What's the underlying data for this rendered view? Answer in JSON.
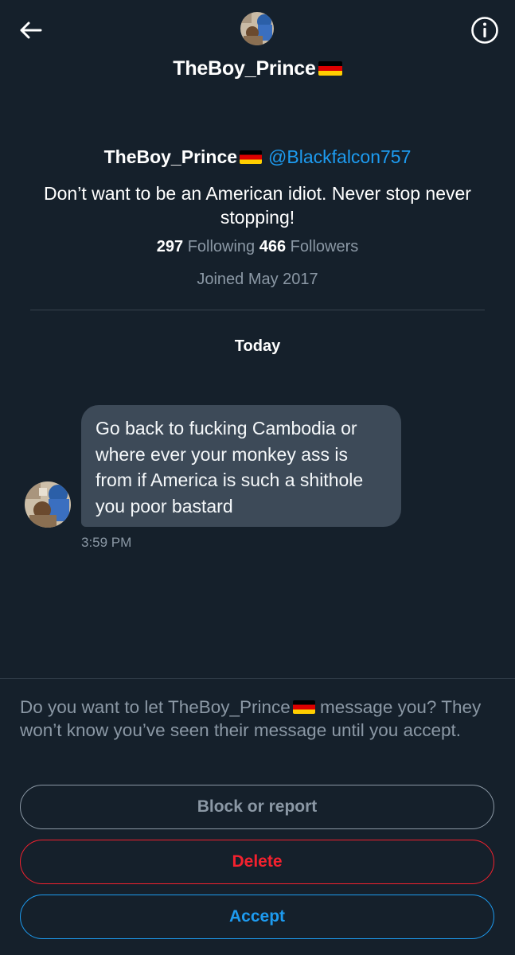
{
  "header": {
    "title": "TheBoy_Prince",
    "back_icon": "arrow-left-icon",
    "info_icon": "info-circle-icon"
  },
  "profile": {
    "name": "TheBoy_Prince",
    "handle": "@Blackfalcon757",
    "bio": "Don’t want to be an American idiot. Never stop never stopping!",
    "following_count": "297",
    "following_label": "Following",
    "followers_count": "466",
    "followers_label": "Followers",
    "joined": "Joined May 2017"
  },
  "conversation": {
    "day_label": "Today",
    "messages": [
      {
        "text": "Go back to fucking Cambodia or where ever your monkey ass is from if America is such a shithole you poor bastard",
        "time": "3:59 PM"
      }
    ]
  },
  "request": {
    "prompt_before_flag": "Do you want to let TheBoy_Prince",
    "prompt_after_flag": " message you? They won’t know you’ve seen their message until you accept.",
    "block_label": "Block or report",
    "delete_label": "Delete",
    "accept_label": "Accept"
  },
  "colors": {
    "background": "#15202b",
    "accent": "#1d9bf0",
    "danger": "#f4212e",
    "muted": "#8b98a5",
    "bubble": "#3d4a58"
  }
}
